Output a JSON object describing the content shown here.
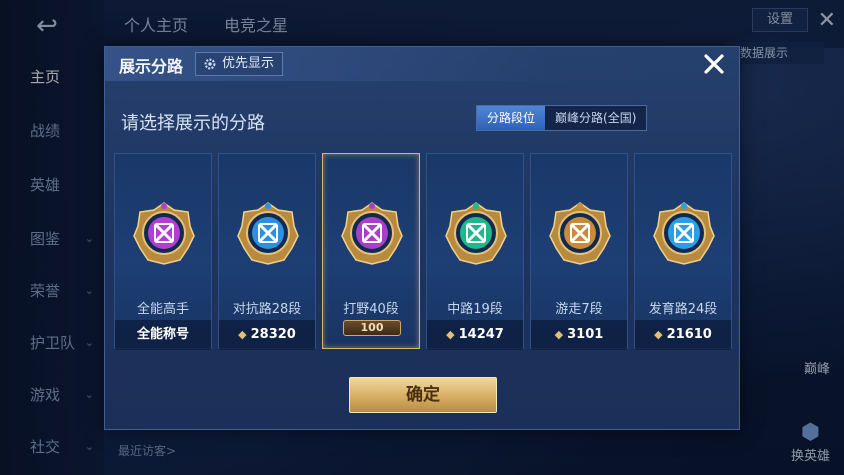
{
  "background": {
    "nav": [
      {
        "label": "主页",
        "active": true,
        "chevron": false
      },
      {
        "label": "战绩",
        "active": false,
        "chevron": false
      },
      {
        "label": "英雄",
        "active": false,
        "chevron": false
      },
      {
        "label": "图鉴",
        "active": false,
        "chevron": true
      },
      {
        "label": "荣誉",
        "active": false,
        "chevron": true
      },
      {
        "label": "护卫队",
        "active": false,
        "chevron": true
      },
      {
        "label": "游戏",
        "active": false,
        "chevron": true
      },
      {
        "label": "社交",
        "active": false,
        "chevron": true
      }
    ],
    "tabs": [
      "个人主页",
      "电竞之星"
    ],
    "settings_label": "设置",
    "data_show_label": "和数据展示",
    "visits_label": "最近访客>",
    "profile_tag_label": "巅峰",
    "hero_swap_label": "换英雄"
  },
  "dialog": {
    "title": "展示分路",
    "priority_label": "优先显示",
    "subtitle": "请选择展示的分路",
    "segment": {
      "options": [
        "分路段位",
        "巅峰分路(全国)"
      ],
      "selected": 0
    },
    "cards": [
      {
        "label": "全能高手",
        "footer": "全能称号",
        "footer_type": "title",
        "badge_color": "#b23fd1",
        "selected": false
      },
      {
        "label": "对抗路28段",
        "footer": "28320",
        "footer_type": "score",
        "badge_color": "#2f8fe0",
        "selected": false
      },
      {
        "label": "打野40段",
        "footer": "100",
        "footer_type": "stars",
        "badge_color": "#a83fc9",
        "selected": true
      },
      {
        "label": "中路19段",
        "footer": "14247",
        "footer_type": "score",
        "badge_color": "#1fb88a",
        "selected": false
      },
      {
        "label": "游走7段",
        "footer": "3101",
        "footer_type": "score",
        "badge_color": "#c98a3a",
        "selected": false
      },
      {
        "label": "发育路24段",
        "footer": "21610",
        "footer_type": "score",
        "badge_color": "#2b9ee8",
        "selected": false
      }
    ],
    "confirm_label": "确定"
  }
}
